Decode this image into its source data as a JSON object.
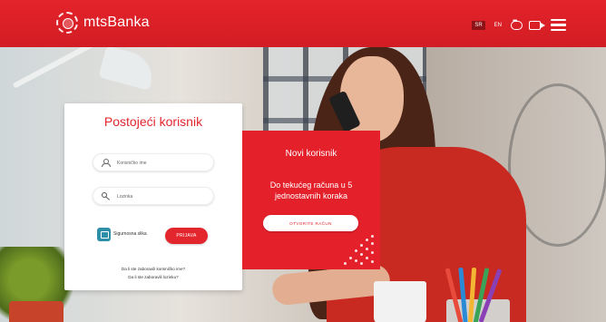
{
  "header": {
    "brand": "mtsBanka",
    "lang_sr": "SR",
    "lang_en": "EN",
    "icons": [
      "chat-icon",
      "video-icon",
      "menu-icon"
    ],
    "brand_color": "#e3262e"
  },
  "login": {
    "title": "Postojeći korisnik",
    "username_placeholder": "Korisničko ime",
    "password_placeholder": "Lozinka",
    "secure_image_label": "Sigurnosna slika",
    "login_button": "PRIJAVA",
    "forgot_username": "Da li ste zaboravili korisničko ime?",
    "forgot_password": "Da li ste zaboravili lozinku?"
  },
  "new_user": {
    "title": "Novi korisnik",
    "description": "Do tekućeg računa u 5 jednostavnih koraka",
    "open_account_button": "OTVORITE RAČUN"
  }
}
